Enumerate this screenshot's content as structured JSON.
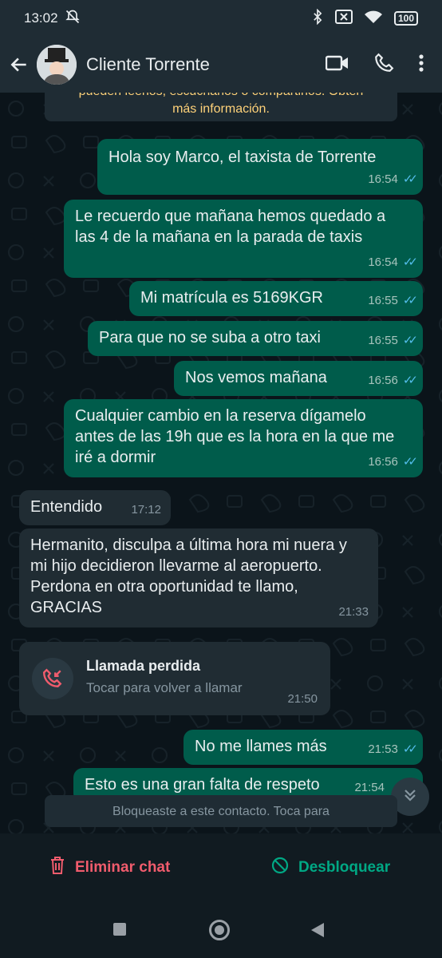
{
  "status_bar": {
    "time": "13:02",
    "battery": "100"
  },
  "header": {
    "contact_name": "Cliente Torrente"
  },
  "notice_top": {
    "line1": "pueden leerlos, escucharlos o compartirlos. Obtén",
    "line2": "más información."
  },
  "messages": [
    {
      "dir": "out",
      "text": "Hola soy Marco, el taxista de Torrente",
      "time": "16:54"
    },
    {
      "dir": "out",
      "text": "Le recuerdo que mañana hemos quedado a las 4 de la mañana en la parada de taxis",
      "time": "16:54"
    },
    {
      "dir": "out",
      "text": "Mi matrícula es 5169KGR",
      "time": "16:55"
    },
    {
      "dir": "out",
      "text": "Para que no se suba a otro taxi",
      "time": "16:55"
    },
    {
      "dir": "out",
      "text": "Nos vemos mañana",
      "time": "16:56"
    },
    {
      "dir": "out",
      "text": "Cualquier cambio en la reserva dígamelo antes de las 19h que es la hora en la que me iré a dormir",
      "time": "16:56"
    },
    {
      "dir": "in",
      "text": "Entendido",
      "time": "17:12"
    },
    {
      "dir": "in",
      "text": "Hermanito, disculpa a última hora mi nuera y mi hijo decidieron llevarme al aeropuerto. Perdona en otra oportunidad te llamo, GRACIAS",
      "time": "21:33"
    },
    {
      "dir": "out",
      "text": "No me llames más",
      "time": "21:53"
    },
    {
      "dir": "out",
      "text": "Esto es una gran falta de respeto",
      "time": "21:54"
    }
  ],
  "missed_call": {
    "title": "Llamada perdida",
    "subtitle": "Tocar para volver a llamar",
    "time": "21:50"
  },
  "notice_bottom": {
    "text": "Bloqueaste a este contacto. Toca para"
  },
  "actions": {
    "delete_label": "Eliminar chat",
    "unblock_label": "Desbloquear"
  },
  "colors": {
    "outgoing": "#005c4b",
    "incoming": "#202c33",
    "delete": "#f15c6d",
    "unblock": "#00a884",
    "read_ticks": "#53bdeb"
  },
  "icons": [
    "bell-off-icon",
    "bluetooth-icon",
    "sim-x-icon",
    "wifi-icon",
    "battery-icon",
    "back-arrow-icon",
    "video-call-icon",
    "phone-icon",
    "more-vert-icon",
    "missed-call-icon",
    "scroll-down-icon",
    "trash-icon",
    "unblock-icon"
  ]
}
